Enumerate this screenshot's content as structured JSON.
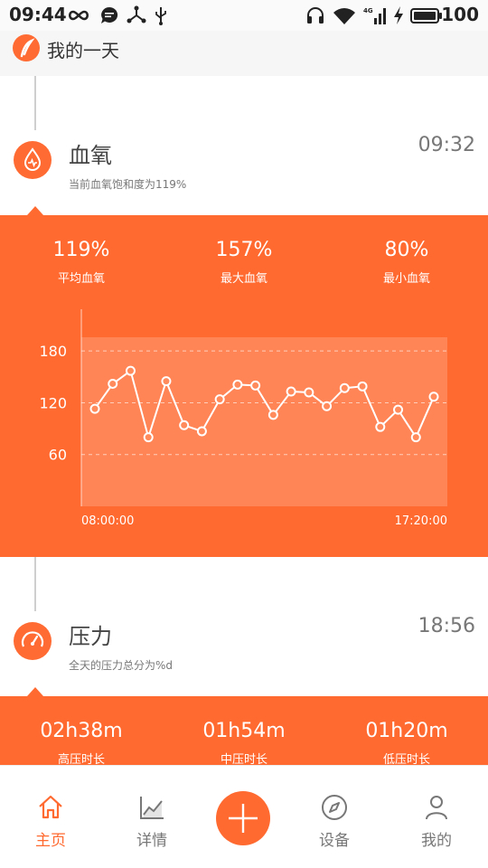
{
  "status_bar": {
    "time": "09:44",
    "battery": "100",
    "icons": [
      "infinity-icon",
      "chat-icon",
      "share-icon",
      "usb-icon",
      "headset-icon",
      "wifi-icon",
      "signal-4g-icon",
      "charging-icon",
      "battery-icon"
    ]
  },
  "header": {
    "title": "我的一天",
    "logo_icon": "feather-logo-icon"
  },
  "blood_oxygen": {
    "title": "血氧",
    "time": "09:32",
    "subtitle": "当前血氧饱和度为119%",
    "icon": "blood-drop-icon",
    "stats": [
      {
        "value": "119%",
        "label": "平均血氧"
      },
      {
        "value": "157%",
        "label": "最大血氧"
      },
      {
        "value": "80%",
        "label": "最小血氧"
      }
    ]
  },
  "chart_data": {
    "type": "line",
    "x_start_label": "08:00:00",
    "x_end_label": "17:20:00",
    "y_ticks": [
      180,
      120,
      60
    ],
    "ylim": [
      0,
      220
    ],
    "grid": true,
    "series": [
      {
        "values": [
          113,
          142,
          157,
          80,
          145,
          94,
          87,
          124,
          141,
          140,
          106,
          133,
          132,
          116,
          137,
          139,
          92,
          112,
          80,
          127
        ]
      }
    ],
    "colors": {
      "line": "#ffffff",
      "plot_bg": "rgba(255,255,255,0.18)"
    }
  },
  "stress": {
    "title": "压力",
    "time": "18:56",
    "subtitle": "全天的压力总分为%d",
    "icon": "speedometer-icon",
    "stats": [
      {
        "value": "02h38m",
        "label": "高压时长"
      },
      {
        "value": "01h54m",
        "label": "中压时长"
      },
      {
        "value": "01h20m",
        "label": "低压时长"
      }
    ]
  },
  "bottom_nav": {
    "items": [
      {
        "label": "主页",
        "icon": "home-icon",
        "active": true
      },
      {
        "label": "详情",
        "icon": "chart-icon",
        "active": false
      },
      {
        "label": "设备",
        "icon": "compass-icon",
        "active": false
      },
      {
        "label": "我的",
        "icon": "person-icon",
        "active": false
      }
    ],
    "fab_icon": "plus-icon"
  },
  "colors": {
    "accent": "#ff6a31",
    "text": "#444444",
    "muted": "#777777"
  }
}
